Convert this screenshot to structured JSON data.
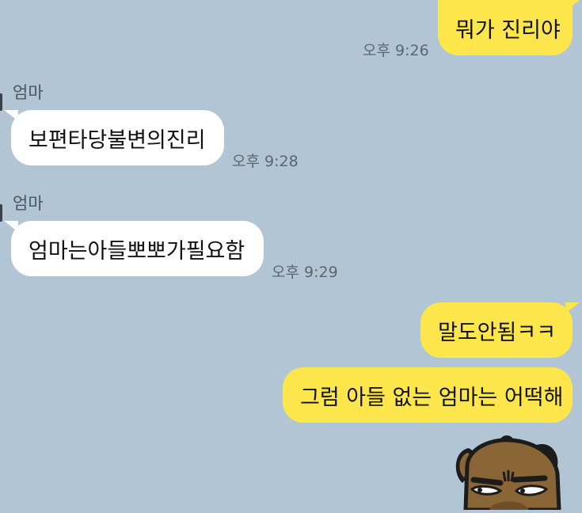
{
  "messages": [
    {
      "id": "m1",
      "sender": "",
      "text": "뭐가 진리야",
      "time": "오후 9:26"
    },
    {
      "id": "m2",
      "sender": "엄마",
      "text": "보편타당불변의진리",
      "time": "오후 9:28"
    },
    {
      "id": "m3",
      "sender": "엄마",
      "text": "엄마는아들뽀뽀가필요함",
      "time": "오후 9:29"
    },
    {
      "id": "m4",
      "sender": "",
      "text": "말도안됨ㅋㅋ",
      "time": ""
    },
    {
      "id": "m5",
      "sender": "",
      "text": "그럼 아들 없는 엄마는 어떡해",
      "time": ""
    }
  ],
  "sticker": {
    "icon": "grumpy-dog-sticker",
    "colors": {
      "fur": "#8a6536",
      "dark": "#1c1c1c",
      "eye": "#ffffff"
    }
  },
  "colors": {
    "background": "#b2c5d5",
    "outgoing_bubble": "#fde64b",
    "incoming_bubble": "#ffffff"
  }
}
